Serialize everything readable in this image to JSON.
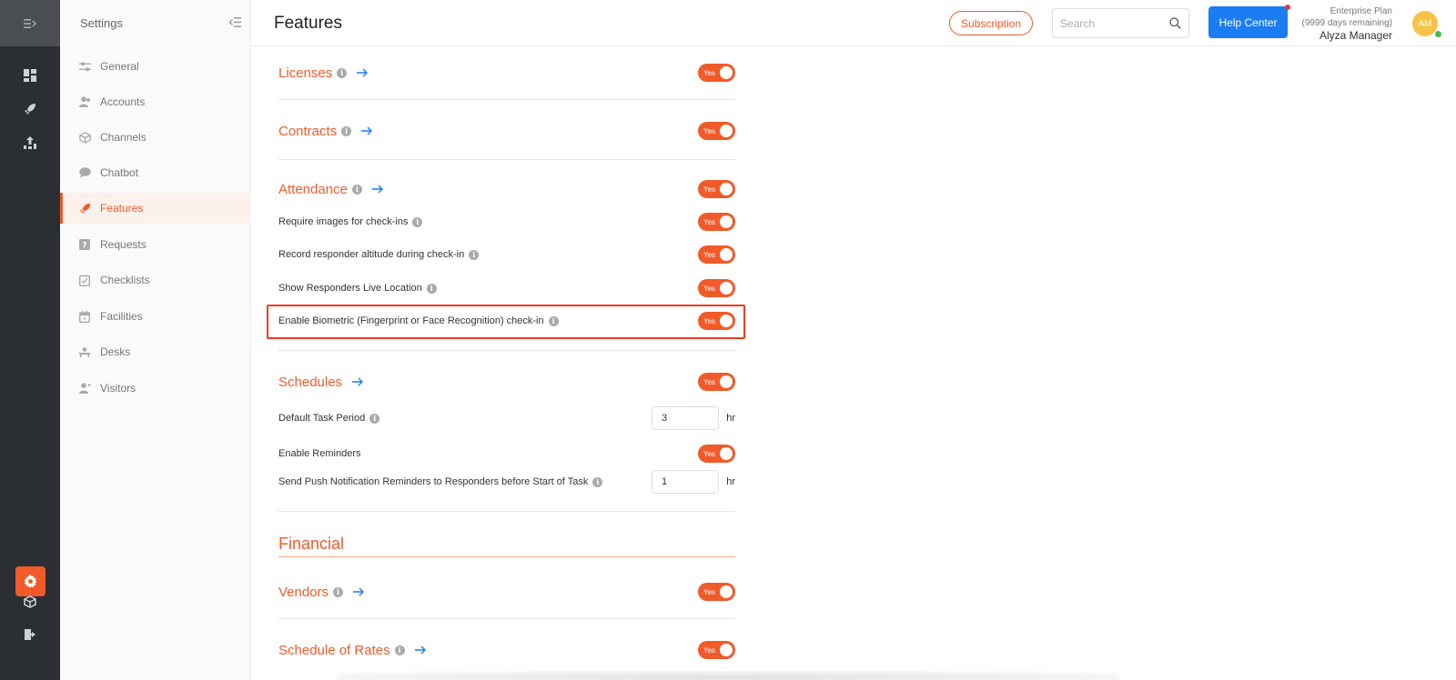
{
  "app": {
    "settings_title": "Settings"
  },
  "sidebar": {
    "items": [
      {
        "label": "General",
        "icon": "sliders-icon"
      },
      {
        "label": "Accounts",
        "icon": "users-icon"
      },
      {
        "label": "Channels",
        "icon": "cube-icon"
      },
      {
        "label": "Chatbot",
        "icon": "chat-icon"
      },
      {
        "label": "Features",
        "icon": "rocket-icon",
        "active": true
      },
      {
        "label": "Requests",
        "icon": "question-icon"
      },
      {
        "label": "Checklists",
        "icon": "checklist-icon"
      },
      {
        "label": "Facilities",
        "icon": "calendar-icon"
      },
      {
        "label": "Desks",
        "icon": "desk-icon"
      },
      {
        "label": "Visitors",
        "icon": "visitor-icon"
      }
    ]
  },
  "header": {
    "title": "Features",
    "subscription_label": "Subscription",
    "search_placeholder": "Search",
    "search_value": "",
    "help_label": "Help Center",
    "plan_name": "Enterprise Plan",
    "plan_remaining": "(9999 days remaining)",
    "user_name": "Alyza Manager",
    "avatar_initials": "AM"
  },
  "features": {
    "licenses": {
      "title": "Licenses",
      "toggle": "Yes"
    },
    "contracts": {
      "title": "Contracts",
      "toggle": "Yes"
    },
    "attendance": {
      "title": "Attendance",
      "toggle": "Yes",
      "opt1": {
        "label": "Require images for check-ins",
        "toggle": "Yes"
      },
      "opt2": {
        "label": "Record responder altitude during check-in",
        "toggle": "Yes"
      },
      "opt3": {
        "label": "Show Responders Live Location",
        "toggle": "Yes"
      },
      "opt4": {
        "label": "Enable Biometric (Fingerprint or Face Recognition) check-in",
        "toggle": "Yes"
      }
    },
    "schedules": {
      "title": "Schedules",
      "toggle": "Yes",
      "task_period": {
        "label": "Default Task Period",
        "value": "3",
        "unit": "hr"
      },
      "reminders": {
        "label": "Enable Reminders",
        "toggle": "Yes"
      },
      "push": {
        "label": "Send Push Notification Reminders to Responders before Start of Task",
        "value": "1",
        "unit": "hr"
      }
    },
    "financial_heading": "Financial",
    "vendors": {
      "title": "Vendors",
      "toggle": "Yes"
    },
    "schedule_of_rates": {
      "title": "Schedule of Rates",
      "toggle": "Yes"
    }
  },
  "colors": {
    "accent": "#f15a29",
    "primary": "#1b7cf3",
    "rail": "#2b2f33",
    "highlight": "#f03a1f"
  },
  "info_glyph": "i"
}
